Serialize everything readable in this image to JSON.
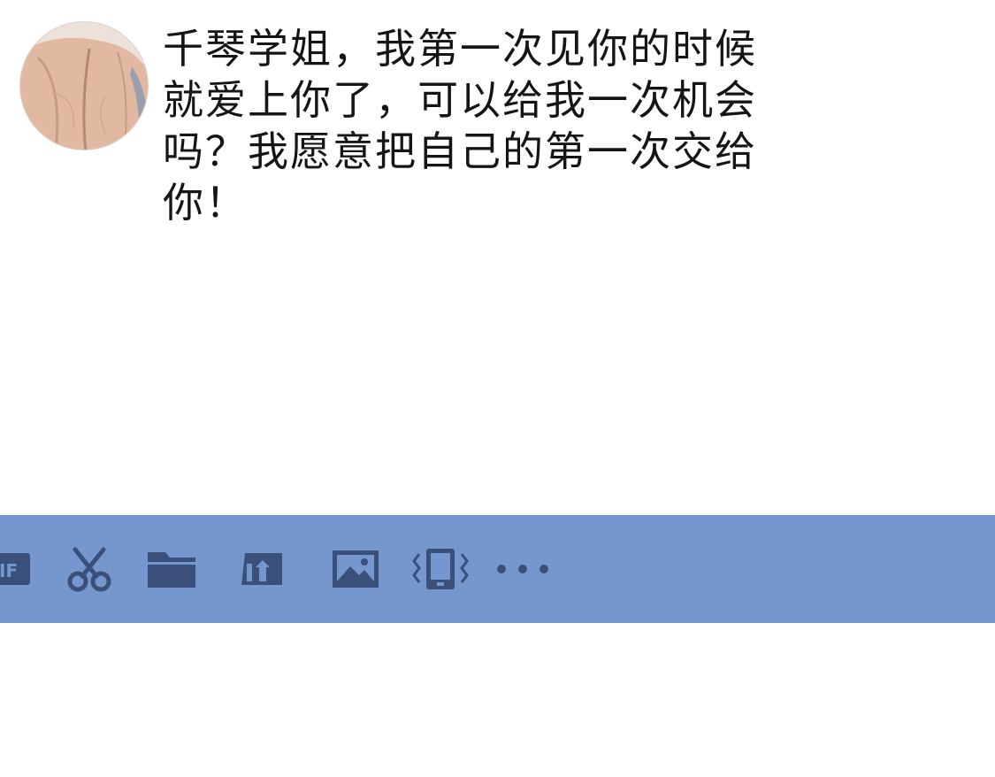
{
  "conversation": {
    "message": {
      "sender_avatar_icon": "avatar-image",
      "text": "千琴学姐，我第一次见你的时候就爱上你了，可以给我一次机会吗？我愿意把自己的第一次交给你！"
    }
  },
  "toolbar": {
    "background_color": "#7597ce",
    "icon_color": "#3a4f7a",
    "items": [
      {
        "icon": "gif-icon"
      },
      {
        "icon": "scissors-icon"
      },
      {
        "icon": "folder-icon"
      },
      {
        "icon": "red-packet-icon"
      },
      {
        "icon": "image-icon"
      },
      {
        "icon": "shake-icon"
      },
      {
        "icon": "more-icon"
      }
    ]
  }
}
